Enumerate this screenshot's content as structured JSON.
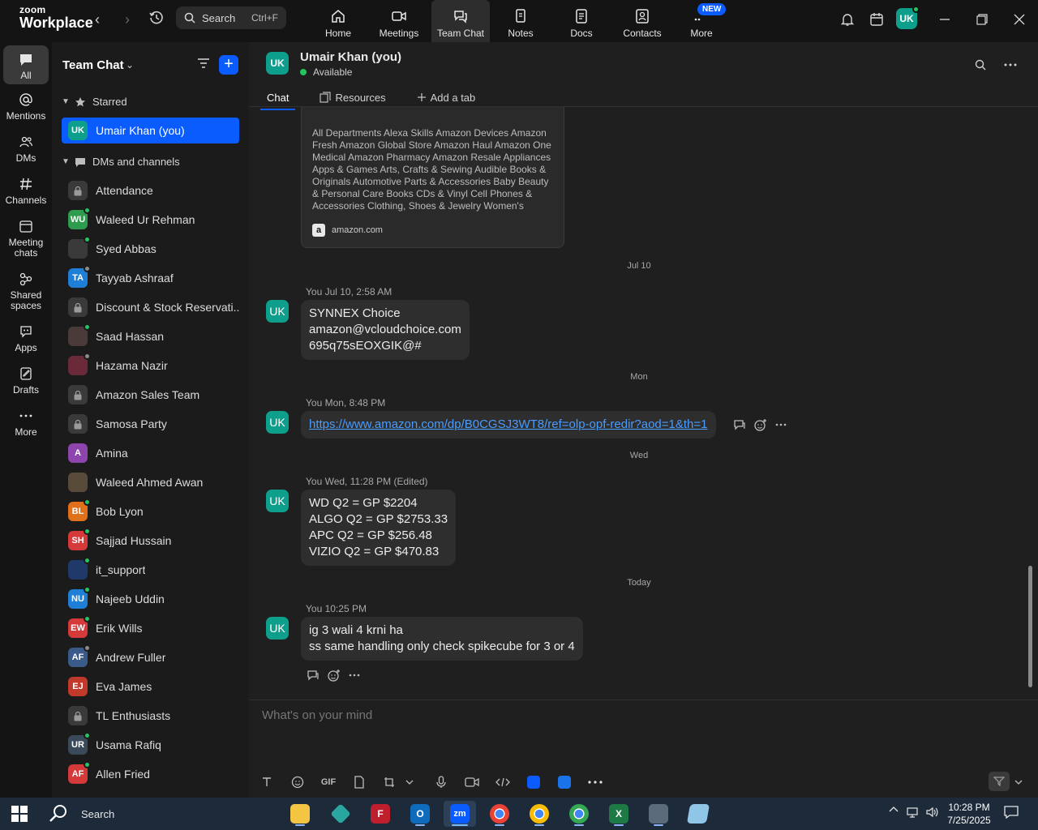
{
  "app": {
    "brand_small": "zoom",
    "brand_large": "Workplace",
    "search_label": "Search",
    "search_shortcut": "Ctrl+F",
    "nav_tabs": [
      {
        "label": "Home",
        "icon": "home-icon"
      },
      {
        "label": "Meetings",
        "icon": "video-icon"
      },
      {
        "label": "Team Chat",
        "icon": "chat-icon"
      },
      {
        "label": "Notes",
        "icon": "notes-icon"
      },
      {
        "label": "Docs",
        "icon": "docs-icon"
      },
      {
        "label": "Contacts",
        "icon": "contacts-icon"
      },
      {
        "label": "More",
        "icon": "more-icon"
      }
    ],
    "new_badge": "NEW",
    "user_initials": "UK",
    "accent": "#0b5cff"
  },
  "rail": [
    {
      "label": "All",
      "icon": "chat-bubble-icon"
    },
    {
      "label": "Mentions",
      "icon": "at-icon"
    },
    {
      "label": "DMs",
      "icon": "people-icon"
    },
    {
      "label": "Channels",
      "icon": "hash-icon"
    },
    {
      "label": "Meeting chats",
      "icon": "calendar-icon"
    },
    {
      "label": "Shared spaces",
      "icon": "shared-icon"
    },
    {
      "label": "Apps",
      "icon": "apps-icon"
    },
    {
      "label": "Drafts",
      "icon": "drafts-icon"
    },
    {
      "label": "More",
      "icon": "more-icon"
    }
  ],
  "sidebar": {
    "title": "Team Chat",
    "starred_label": "Starred",
    "dms_label": "DMs and channels",
    "starred_item": {
      "initials": "UK",
      "name": "Umair Khan (you)"
    },
    "items": [
      {
        "type": "lock",
        "name": "Attendance"
      },
      {
        "type": "avatar",
        "initials": "WU",
        "color": "#2e9c4e",
        "status": "on",
        "name": "Waleed Ur Rehman"
      },
      {
        "type": "photo",
        "initials": "",
        "color": "#3a3a3a",
        "status": "on",
        "name": "Syed Abbas"
      },
      {
        "type": "avatar",
        "initials": "TA",
        "color": "#1f7fd6",
        "status": "off",
        "name": "Tayyab Ashraaf"
      },
      {
        "type": "lock",
        "name": "Discount & Stock Reservati..."
      },
      {
        "type": "photo",
        "initials": "",
        "color": "#4a3a3a",
        "status": "on",
        "name": "Saad Hassan"
      },
      {
        "type": "photo",
        "initials": "",
        "color": "#6a2a3a",
        "status": "off",
        "name": "Hazama Nazir"
      },
      {
        "type": "lock",
        "name": "Amazon Sales Team"
      },
      {
        "type": "lock",
        "name": "Samosa Party"
      },
      {
        "type": "avatar",
        "initials": "A",
        "color": "#8e44ad",
        "status": "",
        "name": "Amina"
      },
      {
        "type": "photo",
        "initials": "",
        "color": "#5a4a3a",
        "status": "",
        "name": "Waleed Ahmed Awan"
      },
      {
        "type": "avatar",
        "initials": "BL",
        "color": "#e0701a",
        "status": "on",
        "name": "Bob Lyon"
      },
      {
        "type": "avatar",
        "initials": "SH",
        "color": "#d43a3a",
        "status": "on",
        "name": "Sajjad Hussain"
      },
      {
        "type": "photo",
        "initials": "",
        "color": "#1f3a6a",
        "status": "on",
        "name": "it_support"
      },
      {
        "type": "avatar",
        "initials": "NU",
        "color": "#1f7fd6",
        "status": "on",
        "name": "Najeeb Uddin"
      },
      {
        "type": "avatar",
        "initials": "EW",
        "color": "#d43a3a",
        "status": "on",
        "name": "Erik Wills"
      },
      {
        "type": "avatar",
        "initials": "AF",
        "color": "#3a5a8a",
        "status": "off",
        "name": "Andrew Fuller"
      },
      {
        "type": "avatar",
        "initials": "EJ",
        "color": "#c0392b",
        "status": "",
        "name": "Eva James"
      },
      {
        "type": "lock",
        "name": "TL Enthusiasts"
      },
      {
        "type": "avatar",
        "initials": "UR",
        "color": "#3a4a5a",
        "status": "on",
        "name": "Usama Rafiq"
      },
      {
        "type": "avatar",
        "initials": "AF",
        "color": "#d43a3a",
        "status": "on",
        "name": "Allen Fried"
      }
    ]
  },
  "chat": {
    "header_initials": "UK",
    "header_name": "Umair Khan (you)",
    "header_status": "Available",
    "tabs": [
      "Chat",
      "Resources",
      "Add a tab"
    ],
    "preview_text": "All Departments Alexa Skills Amazon Devices Amazon Fresh Amazon Global Store Amazon Haul Amazon One Medical Amazon Pharmacy Amazon Resale Appliances Apps & Games Arts, Crafts & Sewing Audible Books & Originals Automotive Parts & Accessories Baby Beauty & Personal Care Books CDs & Vinyl Cell Phones & Accessories Clothing, Shoes & Jewelry Women's",
    "preview_source_icon": "a",
    "preview_source": "amazon.com",
    "dividers": [
      "Jul 10",
      "Mon",
      "Wed",
      "Today"
    ],
    "messages": [
      {
        "initials": "UK",
        "meta": "You Jul 10, 2:58 AM",
        "lines": [
          "SYNNEX Choice",
          "amazon@vcloudchoice.com",
          "695q75sEOXGIK@#"
        ]
      },
      {
        "initials": "UK",
        "meta": "You Mon, 8:48 PM",
        "link": "https://www.amazon.com/dp/B0CGSJ3WT8/ref=olp-opf-redir?aod=1&th=1"
      },
      {
        "initials": "UK",
        "meta": "You Wed, 11:28 PM (Edited)",
        "lines": [
          "WD Q2 = GP $2204",
          "ALGO Q2 = GP $2753.33",
          "APC Q2 = GP $256.48",
          "VIZIO Q2 = GP $470.83"
        ]
      },
      {
        "initials": "UK",
        "meta": "You 10:25 PM",
        "lines": [
          "ig 3 wali 4 krni ha",
          "ss same handling only check spikecube for 3 or 4"
        ]
      }
    ],
    "composer_placeholder": "What's on your mind",
    "composer_gif": "GIF"
  },
  "taskbar": {
    "search": "Search",
    "time": "10:28 PM",
    "date": "7/25/2025",
    "zoom_label": "zm"
  }
}
